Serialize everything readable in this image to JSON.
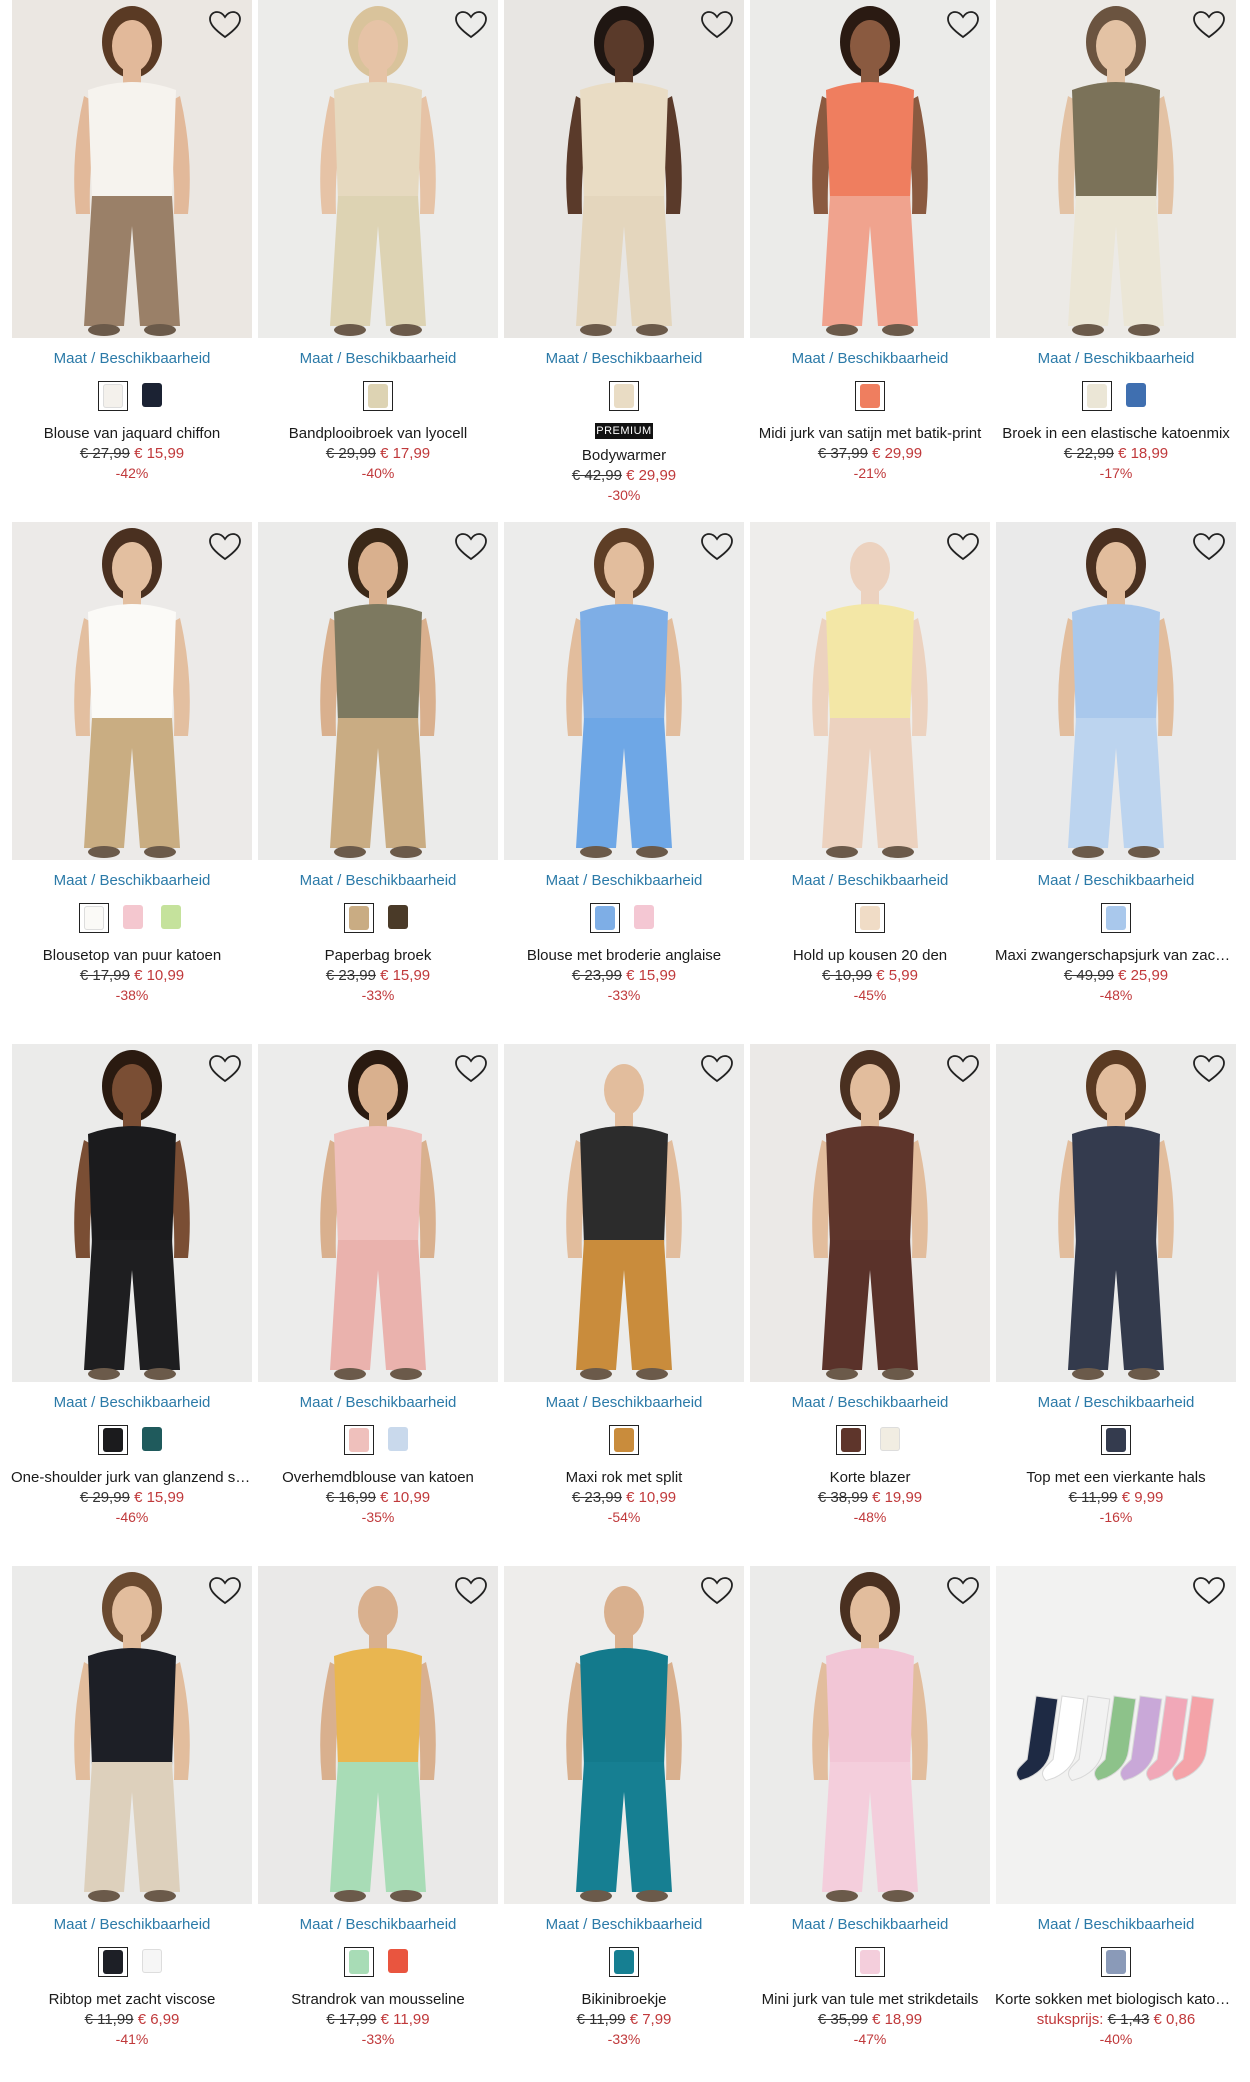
{
  "availability_label": "Maat / Beschikbaarheid",
  "products": [
    {
      "name": "Blouse van jaquard chiffon",
      "old_price": "€ 27,99",
      "new_price": "€ 15,99",
      "discount": "-42%",
      "bg": "#ebe7e2",
      "top": "#f6f3ee",
      "bottom": "#9a8068",
      "skin": "#e2b99a",
      "hair": "#5a3a24",
      "swatches": [
        "#f4f1ec",
        "#1b2233"
      ]
    },
    {
      "name": "Bandplooibroek van lyocell",
      "old_price": "€ 29,99",
      "new_price": "€ 17,99",
      "discount": "-40%",
      "bg": "#ececea",
      "top": "#e6d9bf",
      "bottom": "#ddd3b3",
      "skin": "#e6c3a6",
      "hair": "#d9c39b",
      "swatches": [
        "#ddd3b3"
      ]
    },
    {
      "name": "Bodywarmer",
      "badge": "PREMIUM",
      "old_price": "€ 42,99",
      "new_price": "€ 29,99",
      "discount": "-30%",
      "bg": "#e8e6e3",
      "top": "#e9dcc4",
      "bottom": "#e4d6bd",
      "skin": "#5a3a2a",
      "hair": "#1f1612",
      "swatches": [
        "#e9dcc4"
      ]
    },
    {
      "name": "Midi jurk van satijn met batik-print",
      "old_price": "€ 37,99",
      "new_price": "€ 29,99",
      "discount": "-21%",
      "bg": "#ebebe9",
      "top": "#ef7e5f",
      "bottom": "#f0a38e",
      "skin": "#8a5a40",
      "hair": "#2a1a12",
      "swatches": [
        "#ef7e5f"
      ]
    },
    {
      "name": "Broek in een elastische katoenmix",
      "old_price": "€ 22,99",
      "new_price": "€ 18,99",
      "discount": "-17%",
      "bg": "#eceae6",
      "top": "#7b7259",
      "bottom": "#ebe6d6",
      "skin": "#e3c2a4",
      "hair": "#6b5440",
      "swatches": [
        "#ebe6d6",
        "#3f6fb0"
      ]
    },
    {
      "name": "Blousetop van puur katoen",
      "old_price": "€ 17,99",
      "new_price": "€ 10,99",
      "discount": "-38%",
      "bg": "#eceae8",
      "top": "#fbfaf7",
      "bottom": "#c9ad82",
      "skin": "#e3bfa0",
      "hair": "#4a3020",
      "swatches": [
        "#fbfaf7",
        "#f4c7cf",
        "#c5e29c"
      ]
    },
    {
      "name": "Paperbag broek",
      "old_price": "€ 23,99",
      "new_price": "€ 15,99",
      "discount": "-33%",
      "bg": "#ebebea",
      "top": "#7d7960",
      "bottom": "#c9ac83",
      "skin": "#d9b08e",
      "hair": "#3a2818",
      "swatches": [
        "#c9ac83",
        "#4a3a28"
      ]
    },
    {
      "name": "Blouse met broderie anglaise",
      "old_price": "€ 23,99",
      "new_price": "€ 15,99",
      "discount": "-33%",
      "bg": "#ececeb",
      "top": "#7eaee6",
      "bottom": "#6ea7e6",
      "skin": "#e2bd9d",
      "hair": "#5e3e26",
      "swatches": [
        "#7eaee6",
        "#f4c7d3"
      ]
    },
    {
      "name": "Hold up kousen 20 den",
      "old_price": "€ 10,99",
      "new_price": "€ 5,99",
      "discount": "-45%",
      "bg": "#eeedeb",
      "top": "#f3e7a6",
      "bottom": "#ecd2bf",
      "skin": "#ecd2bf",
      "hair": "#eeedeb",
      "swatches": [
        "#f0dcc6"
      ]
    },
    {
      "name": "Maxi zwangerschapsjurk van zacht …",
      "old_price": "€ 49,99",
      "new_price": "€ 25,99",
      "discount": "-48%",
      "bg": "#eaeaea",
      "top": "#a9c8ec",
      "bottom": "#bcd4ef",
      "skin": "#e2bd9d",
      "hair": "#4a3020",
      "swatches": [
        "#a9c8ec"
      ]
    },
    {
      "name": "One-shoulder jurk van glanzend satijn",
      "old_price": "€ 29,99",
      "new_price": "€ 15,99",
      "discount": "-46%",
      "bg": "#ebebea",
      "top": "#1b1b1d",
      "bottom": "#1e1e20",
      "skin": "#7a4e34",
      "hair": "#2a1a10",
      "swatches": [
        "#1b1b1d",
        "#1f5a5c"
      ]
    },
    {
      "name": "Overhemdblouse van katoen",
      "old_price": "€ 16,99",
      "new_price": "€ 10,99",
      "discount": "-35%",
      "bg": "#ececeb",
      "top": "#efc0bc",
      "bottom": "#eab2ad",
      "skin": "#d9b08e",
      "hair": "#2a1a10",
      "swatches": [
        "#efc0bc",
        "#c9d9ec"
      ]
    },
    {
      "name": "Maxi rok met split",
      "old_price": "€ 23,99",
      "new_price": "€ 10,99",
      "discount": "-54%",
      "bg": "#ececeb",
      "top": "#2c2c2c",
      "bottom": "#c98c3c",
      "skin": "#e2bd9d",
      "hair": "#ececeb",
      "swatches": [
        "#c98c3c"
      ]
    },
    {
      "name": "Korte blazer",
      "old_price": "€ 38,99",
      "new_price": "€ 19,99",
      "discount": "-48%",
      "bg": "#ebe9e7",
      "top": "#5e352b",
      "bottom": "#5a322a",
      "skin": "#e2bd9d",
      "hair": "#4a3020",
      "swatches": [
        "#5e352b",
        "#f1ede2"
      ]
    },
    {
      "name": "Top met een vierkante hals",
      "old_price": "€ 11,99",
      "new_price": "€ 9,99",
      "discount": "-16%",
      "bg": "#ebebea",
      "top": "#343b4e",
      "bottom": "#333a4c",
      "skin": "#e2bd9d",
      "hair": "#5a3a22",
      "swatches": [
        "#343b4e"
      ]
    },
    {
      "name": "Ribtop met zacht viscose",
      "old_price": "€ 11,99",
      "new_price": "€ 6,99",
      "discount": "-41%",
      "bg": "#ebebea",
      "top": "#1d1f26",
      "bottom": "#ddd0bc",
      "skin": "#e2bd9d",
      "hair": "#6a4a30",
      "swatches": [
        "#1d1f26",
        "#f6f6f6"
      ]
    },
    {
      "name": "Strandrok van mousseline",
      "old_price": "€ 17,99",
      "new_price": "€ 11,99",
      "discount": "-33%",
      "bg": "#eae9e8",
      "top": "#e9b650",
      "bottom": "#a8dcb6",
      "skin": "#d9b08e",
      "hair": "#eae9e8",
      "swatches": [
        "#a8dcb6",
        "#e9553f"
      ]
    },
    {
      "name": "Bikinibroekje",
      "old_price": "€ 11,99",
      "new_price": "€ 7,99",
      "discount": "-33%",
      "bg": "#eeedeb",
      "top": "#137a8c",
      "bottom": "#167f92",
      "skin": "#d9b08e",
      "hair": "#eeedeb",
      "swatches": [
        "#167f92"
      ]
    },
    {
      "name": "Mini jurk van tule met strikdetails",
      "old_price": "€ 35,99",
      "new_price": "€ 18,99",
      "discount": "-47%",
      "bg": "#ebebea",
      "top": "#f2c6d6",
      "bottom": "#f4cedc",
      "skin": "#e2bd9d",
      "hair": "#4a3020",
      "swatches": [
        "#f4cedc"
      ]
    },
    {
      "name": "Korte sokken met biologisch katoe…",
      "unit_label": "stuksprijs:",
      "old_price": "€ 1,43",
      "new_price": "€ 0,86",
      "discount": "-40%",
      "bg": "#f2f2f1",
      "top": "#f2f2f1",
      "bottom": "#f2f2f1",
      "skin": "#f2f2f1",
      "hair": "#f2f2f1",
      "swatches": [
        "#8a9ab8"
      ],
      "socks": [
        "#1e2a44",
        "#ffffff",
        "#f2f2f2",
        "#8dc28a",
        "#c9a8d8",
        "#f1a8b8",
        "#f4a3a8"
      ]
    }
  ]
}
